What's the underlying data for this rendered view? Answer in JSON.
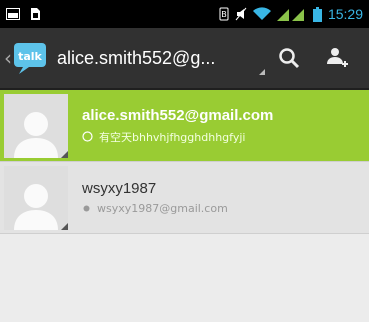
{
  "status_bar": {
    "time": "15:29",
    "colors": {
      "background": "#000000",
      "time": "#39b6e5",
      "wifi": "#39b6e5",
      "signal": "#8bc34a"
    },
    "icons": [
      "screenshot-icon",
      "sim-icon",
      "battery-saver-icon",
      "mute-icon",
      "wifi-icon",
      "signal-icon",
      "battery-icon"
    ]
  },
  "action_bar": {
    "title": "alice.smith552@g...",
    "logo": "talk-logo",
    "actions": [
      "search-icon",
      "add-friend-icon"
    ],
    "colors": {
      "background": "#313131"
    }
  },
  "contacts": [
    {
      "email": "alice.smith552@gmail.com",
      "status_message": "有空天bhhvhjfhgghdhhgfyji",
      "selected": true,
      "status_icon": "available-status-icon"
    },
    {
      "name": "wsyxy1987",
      "email": "wsyxy1987@gmail.com",
      "selected": false,
      "status_icon": "offline-status-icon"
    }
  ],
  "colors": {
    "selected_row": "#99cc33",
    "row": "#e3e3e3",
    "list_background": "#ececec"
  }
}
